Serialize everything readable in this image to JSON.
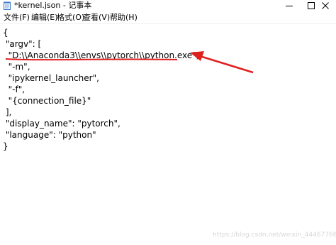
{
  "window": {
    "title": "*kernel.json - 记事本",
    "controls": {
      "minimize": "minimize",
      "maximize": "maximize",
      "close": "close"
    }
  },
  "menu": [
    {
      "label": "文件(F)"
    },
    {
      "label": "编辑(E)"
    },
    {
      "label": "格式(O)"
    },
    {
      "label": "查看(V)"
    },
    {
      "label": "帮助(H)"
    }
  ],
  "editor": {
    "lines": [
      "{",
      " \"argv\": [",
      "  \"D:\\\\Anaconda3\\\\envs\\\\pytorch\\\\python.exe\",",
      "  \"-m\",",
      "  \"ipykernel_launcher\",",
      "  \"-f\",",
      "  \"{connection_file}\"",
      " ],",
      " \"display_name\": \"pytorch\",",
      " \"language\": \"python\"",
      "}"
    ]
  },
  "annotation": {
    "color": "#e0201f"
  },
  "watermark": "https://blog.csdn.net/weixin_44467766"
}
